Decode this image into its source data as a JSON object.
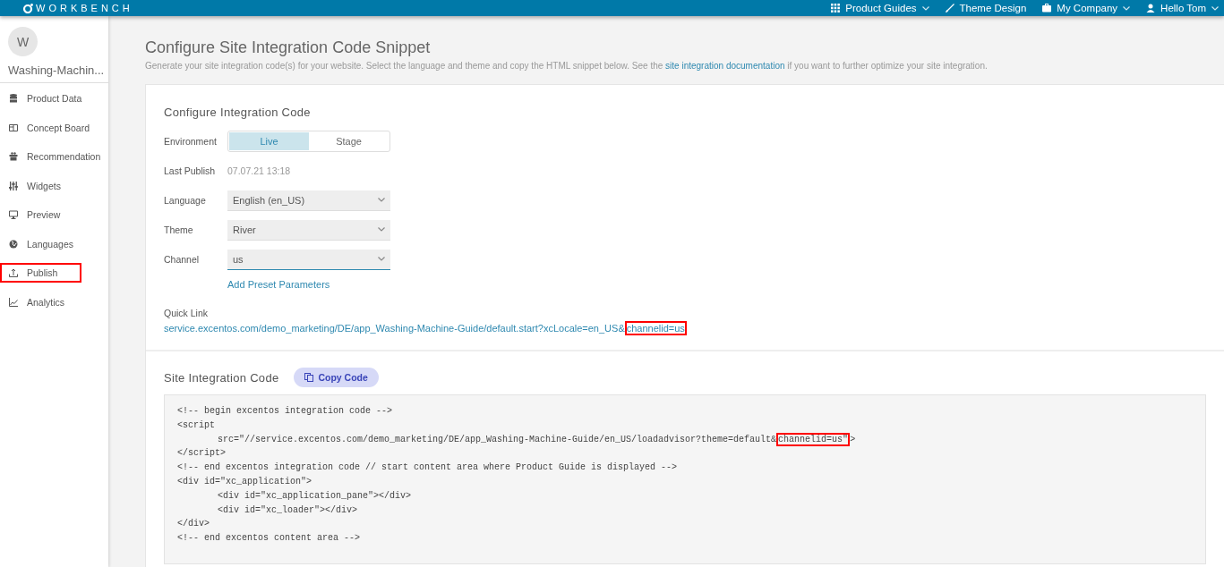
{
  "header": {
    "logo": "WORKBENCH",
    "nav": [
      {
        "label": "Product Guides",
        "dropdown": true
      },
      {
        "label": "Theme Design",
        "dropdown": false
      },
      {
        "label": "My Company",
        "dropdown": true
      },
      {
        "label": "Hello Tom",
        "dropdown": true
      }
    ]
  },
  "sidebar": {
    "avatar": "W",
    "project": "Washing-Machin...",
    "items": [
      {
        "label": "Product Data",
        "highlighted": false
      },
      {
        "label": "Concept Board",
        "highlighted": false
      },
      {
        "label": "Recommendation",
        "highlighted": false
      },
      {
        "label": "Widgets",
        "highlighted": false
      },
      {
        "label": "Preview",
        "highlighted": false
      },
      {
        "label": "Languages",
        "highlighted": false
      },
      {
        "label": "Publish",
        "highlighted": true
      },
      {
        "label": "Analytics",
        "highlighted": false
      }
    ]
  },
  "page": {
    "title": "Configure Site Integration Code Snippet",
    "description": [
      {
        "kind": "text",
        "text": "Generate your site integration code(s) for your website. Select the language and theme and copy the HTML snippet below. See the "
      },
      {
        "kind": "link",
        "text": "site integration documentation"
      },
      {
        "kind": "text",
        "text": " if you want to further optimize your site integration."
      }
    ]
  },
  "configure": {
    "title": "Configure Integration Code",
    "environment": {
      "label": "Environment",
      "options": [
        {
          "label": "Live",
          "selected": true
        },
        {
          "label": "Stage",
          "selected": false
        }
      ]
    },
    "last_publish": {
      "label": "Last Publish",
      "value": "07.07.21 13:18"
    },
    "selects": [
      {
        "label": "Language",
        "value": "English (en_US)",
        "focused": false
      },
      {
        "label": "Theme",
        "value": "River",
        "focused": false
      },
      {
        "label": "Channel",
        "value": "us",
        "focused": true
      }
    ],
    "add_link": "Add Preset Parameters",
    "quick_link": {
      "label": "Quick Link",
      "text": "service.excentos.com/demo_marketing/DE/app_Washing-Machine-Guide/default.start?xcLocale=en_US&",
      "highlight": "channelid=us"
    }
  },
  "integration": {
    "title": "Site Integration Code",
    "copy_button": "Copy Code",
    "lines": [
      {
        "indent": false,
        "text": "<!-- begin excentos integration code -->"
      },
      {
        "indent": false,
        "text": "<script"
      },
      {
        "indent": true,
        "text": "src=\"//service.excentos.com/demo_marketing/DE/app_Washing-Machine-Guide/en_US/loadadvisor?theme=default&",
        "highlight": "channelid=us\"",
        "after": ">"
      },
      {
        "indent": false,
        "text": "</script>"
      },
      {
        "indent": false,
        "text": "<!-- end excentos integration code // start content area where Product Guide is displayed -->"
      },
      {
        "indent": false,
        "text": "<div id=\"xc_application\">"
      },
      {
        "indent": true,
        "text": "<div id=\"xc_application_pane\"></div>"
      },
      {
        "indent": true,
        "text": "<div id=\"xc_loader\"></div>"
      },
      {
        "indent": false,
        "text": "</div>"
      },
      {
        "indent": false,
        "text": "<!-- end excentos content area -->"
      }
    ]
  }
}
